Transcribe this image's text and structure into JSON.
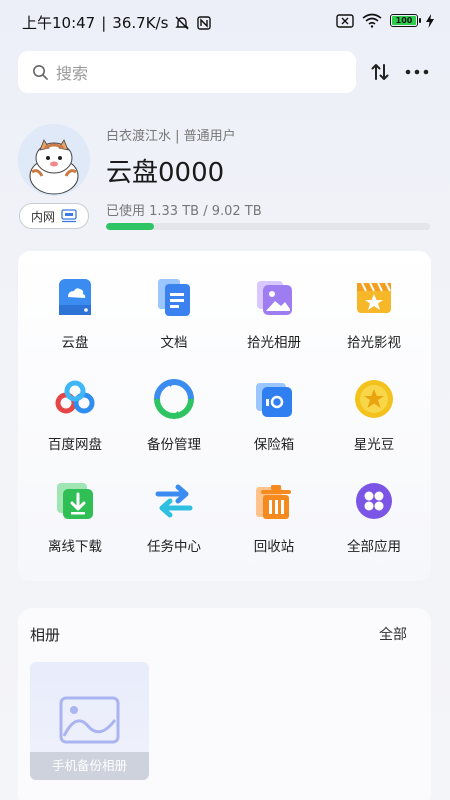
{
  "status_bar": {
    "time": "上午10:47",
    "speed": "36.7K/s",
    "battery": "100"
  },
  "search": {
    "placeholder": "搜索"
  },
  "profile": {
    "user_line": "白衣渡江水 | 普通用户",
    "disk_title": "云盘0000",
    "usage_text": "已使用 1.33 TB / 9.02 TB",
    "usage_fraction": 0.147,
    "network_badge": "内网"
  },
  "grid": [
    {
      "label": "云盘",
      "icon": "cloud-drive-icon"
    },
    {
      "label": "文档",
      "icon": "document-icon"
    },
    {
      "label": "拾光相册",
      "icon": "photo-album-icon"
    },
    {
      "label": "拾光影视",
      "icon": "video-icon"
    },
    {
      "label": "百度网盘",
      "icon": "baidu-netdisk-icon"
    },
    {
      "label": "备份管理",
      "icon": "backup-icon"
    },
    {
      "label": "保险箱",
      "icon": "safe-icon"
    },
    {
      "label": "星光豆",
      "icon": "star-bean-icon"
    },
    {
      "label": "离线下载",
      "icon": "offline-download-icon"
    },
    {
      "label": "任务中心",
      "icon": "task-center-icon"
    },
    {
      "label": "回收站",
      "icon": "recycle-bin-icon"
    },
    {
      "label": "全部应用",
      "icon": "all-apps-icon"
    }
  ],
  "album": {
    "title": "相册",
    "all_label": "全部",
    "items": [
      {
        "caption": "手机备份相册"
      }
    ]
  },
  "colors": {
    "accent_green": "#2fc463",
    "brand_blue": "#3b8cf0"
  }
}
